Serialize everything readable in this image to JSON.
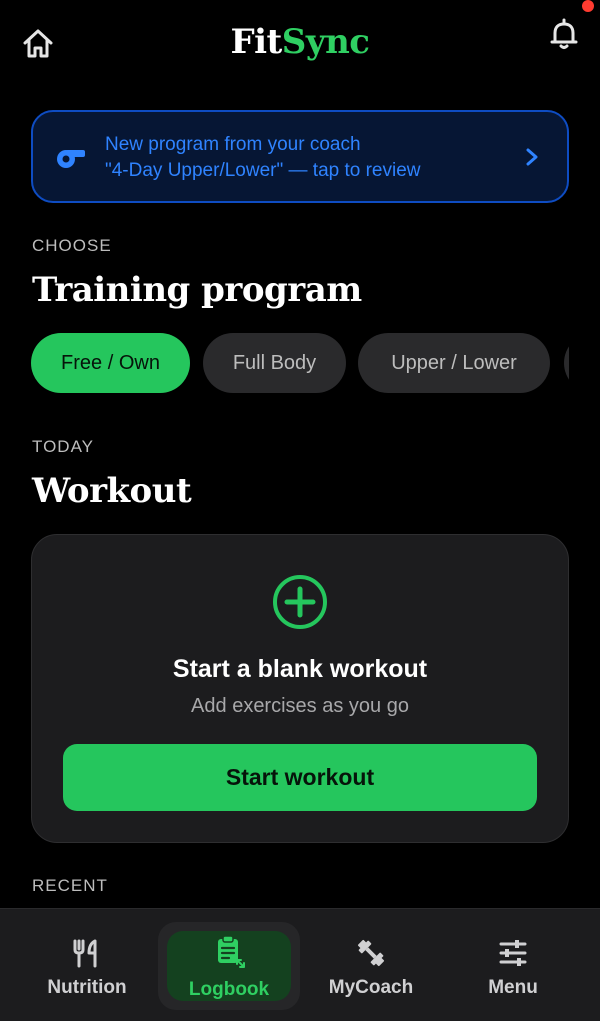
{
  "header": {
    "brand_part1": "Fit",
    "brand_part2": "Sync",
    "home_icon": "home-icon",
    "bell_icon": "bell-icon",
    "notification_dot_color": "#ff3b30"
  },
  "banner": {
    "line1": "New program from your coach",
    "line2": "\"4-Day Upper/Lower\" — tap to review",
    "icon": "whistle-icon",
    "accent_color": "#2f83ff"
  },
  "program": {
    "eyebrow": "CHOOSE",
    "title": "Training program",
    "chips": [
      {
        "label": "Free / Own",
        "active": true
      },
      {
        "label": "Full Body",
        "active": false
      },
      {
        "label": "Upper / Lower",
        "active": false
      }
    ]
  },
  "workout": {
    "eyebrow": "TODAY",
    "title": "Workout",
    "card_title": "Start a blank workout",
    "card_subtitle": "Add exercises as you go",
    "button_label": "Start workout",
    "icon": "plus-circle-icon"
  },
  "recent": {
    "eyebrow": "RECENT"
  },
  "nav": {
    "items": [
      {
        "label": "Nutrition",
        "icon": "fork-knife-icon"
      },
      {
        "label": "Logbook",
        "icon": "clipboard-icon",
        "active": true
      },
      {
        "label": "MyCoach",
        "icon": "dumbbell-icon"
      },
      {
        "label": "Menu",
        "icon": "sliders-icon"
      }
    ]
  },
  "colors": {
    "accent_green": "#25c65d",
    "background": "#000000",
    "card": "#1c1c1e"
  }
}
